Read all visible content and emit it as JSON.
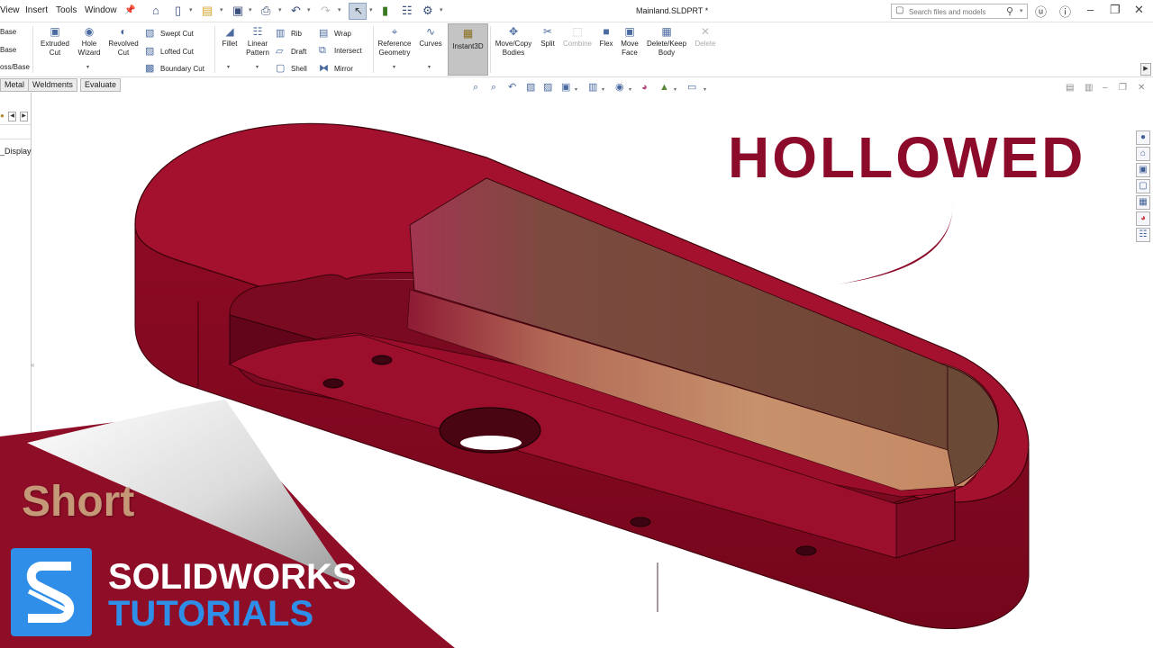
{
  "menu": {
    "items": [
      "View",
      "Insert",
      "Tools",
      "Window"
    ]
  },
  "document_title": "Mainland.SLDPRT *",
  "search": {
    "placeholder": "Search files and models"
  },
  "ribbon": {
    "left_labels": [
      "Base",
      "Base",
      "oss/Base"
    ],
    "tools": {
      "extruded_cut": "Extruded\nCut",
      "hole_wizard": "Hole\nWizard",
      "revolved_cut": "Revolved\nCut",
      "swept_cut": "Swept Cut",
      "lofted_cut": "Lofted Cut",
      "boundary_cut": "Boundary Cut",
      "fillet": "Fillet",
      "linear_pattern": "Linear\nPattern",
      "rib": "Rib",
      "draft": "Draft",
      "shell": "Shell",
      "wrap": "Wrap",
      "intersect": "Intersect",
      "mirror": "Mirror",
      "reference_geometry": "Reference\nGeometry",
      "curves": "Curves",
      "instant3d": "Instant3D",
      "move_copy_bodies": "Move/Copy\nBodies",
      "split": "Split",
      "combine": "Combine",
      "flex": "Flex",
      "move_face": "Move\nFace",
      "delete_keep_body": "Delete/Keep\nBody",
      "delete": "Delete"
    }
  },
  "tabs": [
    "Metal",
    "Weldments",
    "Evaluate"
  ],
  "feature_tree": {
    "item": "_Display"
  },
  "overlay": {
    "headline": "HOLLOWED"
  },
  "branding": {
    "short": "Short",
    "line1": "SOLIDWORKS",
    "line2": "TUTORIALS"
  },
  "colors": {
    "part": "#a3112e",
    "part_dark": "#6e0619",
    "interior": "#c48b68",
    "headline": "#8c0b2a",
    "brand_red": "#8e0d27",
    "brand_blue": "#2f8fe8",
    "brand_gold": "#c59877"
  },
  "icons": [
    "home-icon",
    "new-document-icon",
    "open-icon",
    "save-icon",
    "print-icon",
    "undo-icon",
    "redo-icon",
    "select-icon",
    "traffic-light-icon",
    "file-properties-icon",
    "options-gear-icon",
    "search-icon",
    "user-icon",
    "help-icon",
    "minimize-icon",
    "restore-icon",
    "close-icon"
  ]
}
